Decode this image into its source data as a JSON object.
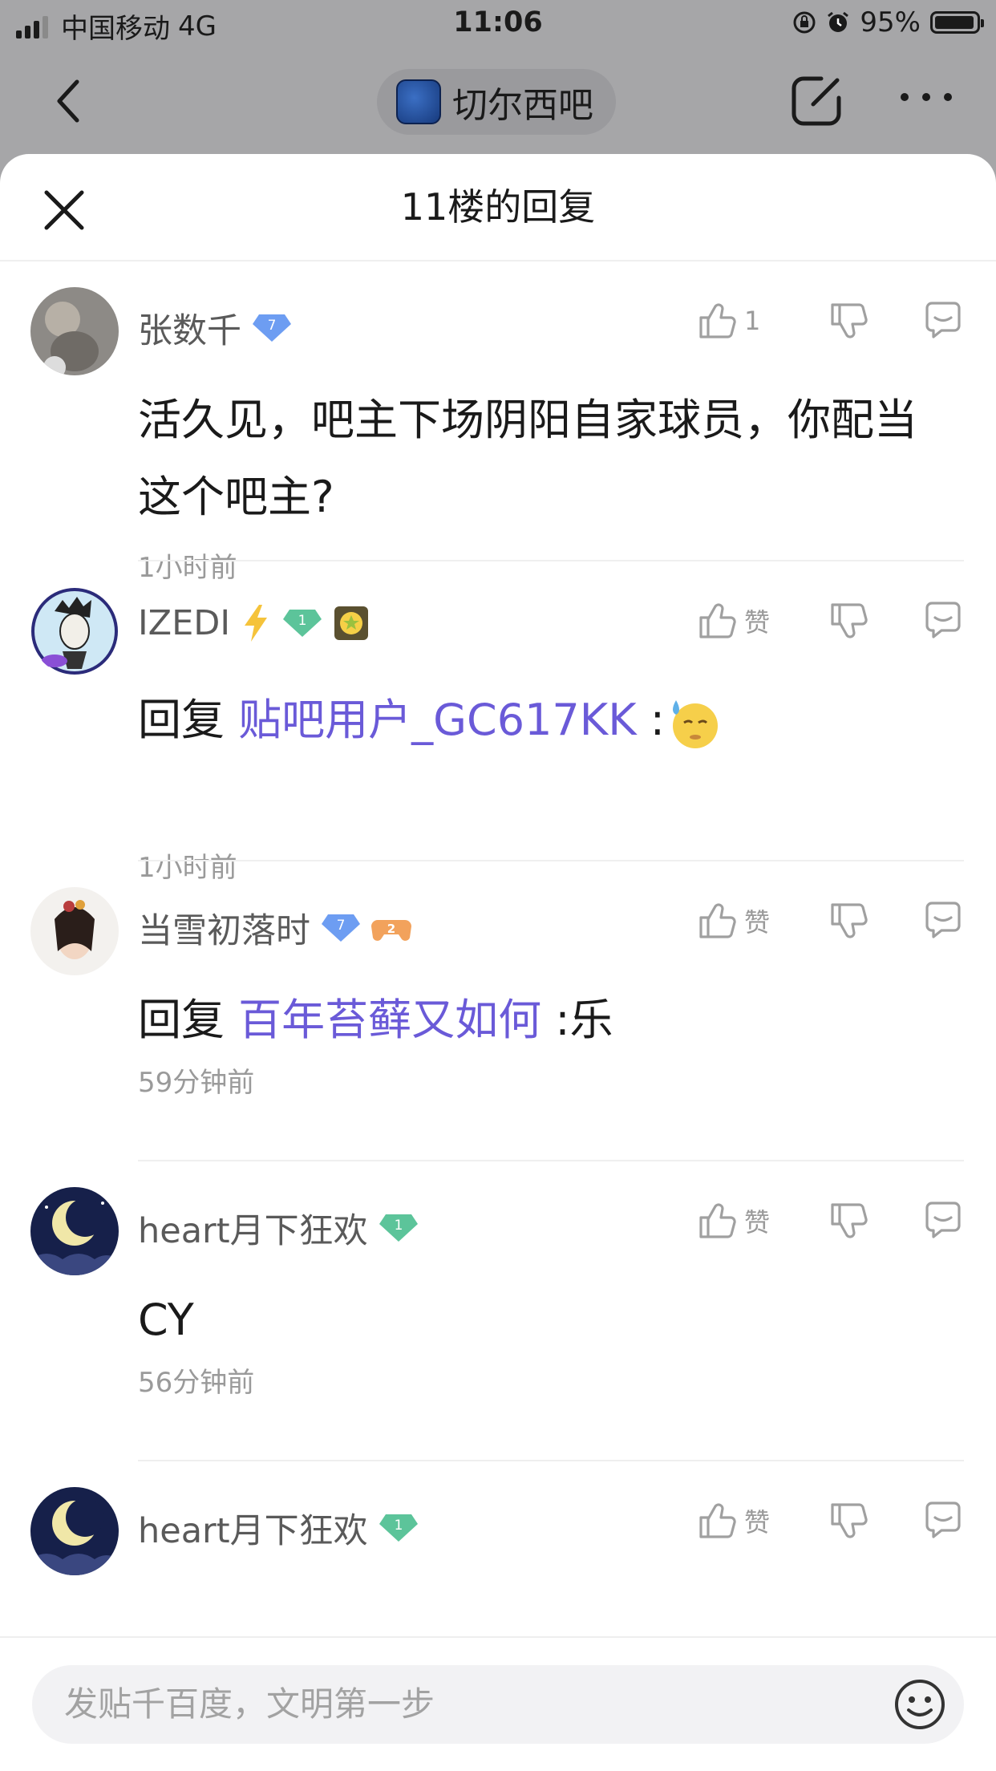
{
  "status_bar": {
    "carrier": "中国移动",
    "network": "4G",
    "time": "11:06",
    "battery": "95%"
  },
  "nav": {
    "forum_name": "切尔西吧",
    "back_icon": "chevron-left-icon",
    "edit_icon": "edit-icon",
    "more_icon": "more-icon"
  },
  "sheet": {
    "title": "11楼的回复"
  },
  "comments": [
    {
      "username": "张数千",
      "level": "7",
      "like_label": "1",
      "body": "活久见，吧主下场阴阳自家球员，你配当这个吧主?",
      "time": "1小时前"
    },
    {
      "username": "IZEDI",
      "level": "1",
      "like_label": "赞",
      "reply_prefix": "回复",
      "mention": "贴吧用户_GC617KK",
      "body_suffix": ":",
      "time": "1小时前"
    },
    {
      "username": "当雪初落时",
      "level": "7",
      "game_level": "2",
      "like_label": "赞",
      "reply_prefix": "回复",
      "mention": "百年苔藓又如何",
      "body_suffix": ":乐",
      "time": "59分钟前"
    },
    {
      "username": "heart月下狂欢",
      "level": "1",
      "like_label": "赞",
      "body": "CY",
      "time": "56分钟前"
    },
    {
      "username": "heart月下狂欢",
      "level": "1",
      "like_label": "赞"
    }
  ],
  "input": {
    "placeholder": "发贴千百度，文明第一步"
  },
  "colors": {
    "mention": "#6a5ad8",
    "blue_badge": "#6d9df2",
    "green_badge": "#5cc49a"
  }
}
